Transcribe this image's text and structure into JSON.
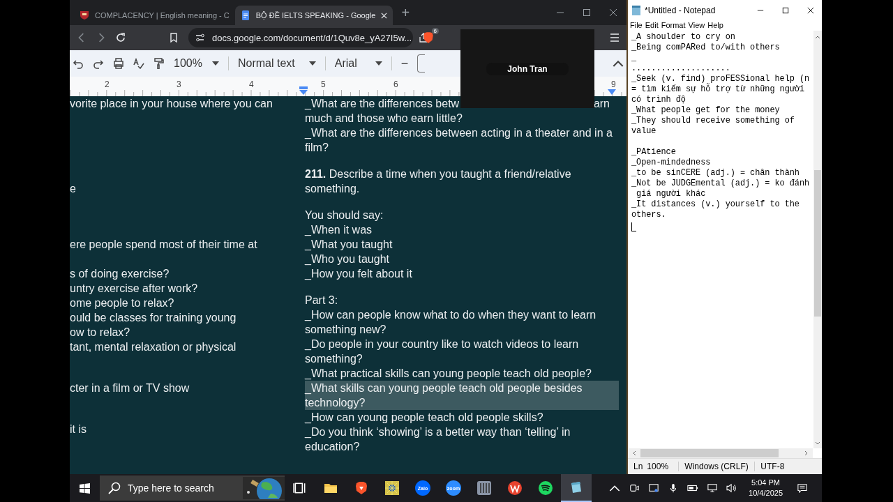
{
  "browser": {
    "tabs": [
      {
        "title": "COMPLACENCY | English meaning - C",
        "selected": false
      },
      {
        "title": "BỘ ĐỀ IELTS SPEAKING - Google",
        "selected": true
      }
    ],
    "new_tab": "+",
    "address": "docs.google.com/document/d/1Quv8e_yA27I5w...",
    "shield_badge": "6"
  },
  "docs_toolbar": {
    "zoom": "100%",
    "style": "Normal text",
    "font": "Arial",
    "minus": "−"
  },
  "ruler": [
    "2",
    "3",
    "4",
    "5",
    "6",
    "9"
  ],
  "video_call": {
    "name": "John Tran"
  },
  "document": {
    "left_column": [
      {
        "text": "vorite place in your house where you can"
      },
      {
        "text": "e"
      },
      {
        "text": "ere people spend most of their time at"
      },
      {
        "text": "s of doing exercise?"
      },
      {
        "text": "untry exercise after work?"
      },
      {
        "text": "ome people to relax?"
      },
      {
        "text": "ould be classes for training young"
      },
      {
        "text": "ow to relax?"
      },
      {
        "text": "tant, mental relaxation or physical"
      },
      {
        "text": "cter in a film or TV show"
      },
      {
        "text": "it is"
      }
    ],
    "right_column": {
      "covered_line": [
        "_What are the differences betw",
        "arn"
      ],
      "paragraphs": [
        [
          {
            "text": "much and those who earn little?",
            "highlighted": false
          },
          {
            "text": "_What are the differences between acting in a theater and in a film?",
            "highlighted": false
          }
        ],
        [
          {
            "text": "**211.** Describe a time when you taught a friend/relative something.",
            "highlighted": false
          }
        ],
        [
          {
            "text": "You should say:",
            "highlighted": false
          },
          {
            "text": "_When it was",
            "highlighted": false
          },
          {
            "text": "_What you taught",
            "highlighted": false
          },
          {
            "text": "_Who you taught",
            "highlighted": false
          },
          {
            "text": "_How you felt about it",
            "highlighted": false
          }
        ],
        [
          {
            "text": "Part 3:",
            "highlighted": false
          },
          {
            "text": "_How can people know what to do when they want to learn something new?",
            "highlighted": false
          },
          {
            "text": "_Do people in your country like to watch videos to learn something?",
            "highlighted": false
          },
          {
            "text": "_What practical skills can young people teach old people?",
            "highlighted": false
          },
          {
            "text": "_What skills can young people teach old people besides technology?",
            "highlighted": true
          },
          {
            "text": "_How can young people teach old people skills?",
            "highlighted": false
          },
          {
            "text": "_Do you think ‘showing’ is a better way than ‘telling’ in education?",
            "highlighted": false
          }
        ]
      ]
    }
  },
  "notepad": {
    "title": "*Untitled - Notepad",
    "menu": [
      "File",
      "Edit",
      "Format",
      "View",
      "Help"
    ],
    "text": "_A shoulder to cry on\n_Being comPARed to/with others\n_\n....................\n_Seek (v. find) proFESSional help (n\n= tìm kiếm sự hỗ trợ từ những người\ncó trình độ\n_What people get for the money\n_They should receive something of\nvalue\n\n_PAtience\n_Open-mindedness\n_to be sinCERE (adj.) = chân thành\n_Not be JUDGEmental (adj.) = ko đánh\n giá người khác\n_It distances (v.) yourself to the\nothers.",
    "status": [
      "Ln",
      "100%",
      "Windows (CRLF)",
      "UTF-8"
    ]
  },
  "taskbar": {
    "search_placeholder": "Type here to search",
    "apps": [
      {
        "kind": "taskview",
        "selected": false
      },
      {
        "kind": "folder",
        "selected": false
      },
      {
        "kind": "lion",
        "selected": false
      },
      {
        "kind": "sun",
        "selected": false
      },
      {
        "kind": "zalo",
        "label": "Zalo",
        "selected": false
      },
      {
        "kind": "zoom",
        "label": "zoom",
        "selected": false
      },
      {
        "kind": "bars",
        "selected": false
      },
      {
        "kind": "wps",
        "selected": false
      },
      {
        "kind": "spotify",
        "selected": false
      },
      {
        "kind": "notepad",
        "selected": true
      }
    ],
    "time": "5:04 PM",
    "date": "10/4/2025"
  }
}
